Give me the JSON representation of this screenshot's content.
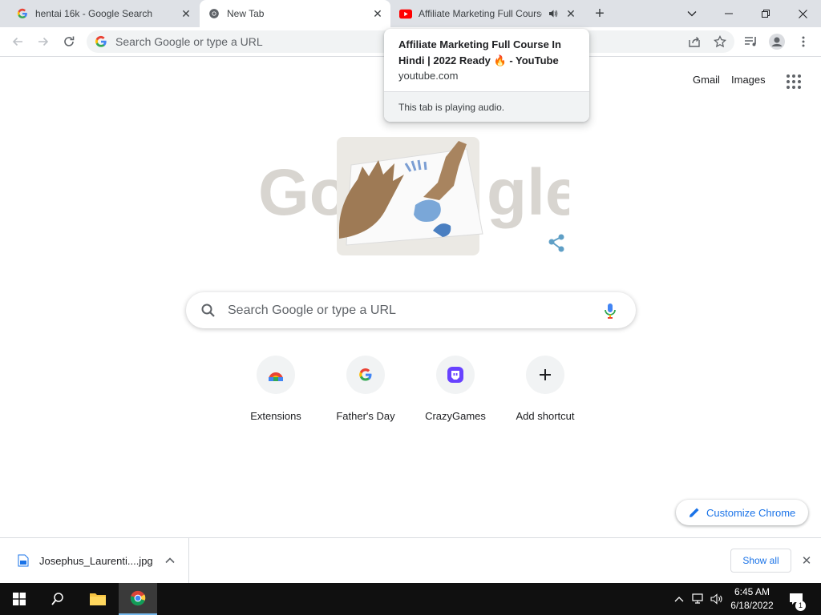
{
  "tabs": [
    {
      "title": "hentai 16k - Google Search",
      "favicon": "google-g-icon"
    },
    {
      "title": "New Tab",
      "favicon": "chrome-icon",
      "active": true
    },
    {
      "title": "Affiliate Marketing Full Course In Hindi | 2022 Ready 🔥 - YouTube",
      "favicon": "youtube-icon",
      "audio": true
    }
  ],
  "window_controls": [
    "tab-search",
    "minimize",
    "restore",
    "close"
  ],
  "omnibox": {
    "placeholder": "Search Google or type a URL"
  },
  "hovercard": {
    "title": "Affiliate Marketing Full Course In Hindi | 2022 Ready 🔥 - YouTube",
    "domain": "youtube.com",
    "status": "This tab is playing audio."
  },
  "ntp": {
    "gmail": "Gmail",
    "images": "Images",
    "search_placeholder": "Search Google or type a URL",
    "shortcuts": [
      {
        "label": "Extensions",
        "icon": "chrome-web-store-icon"
      },
      {
        "label": "Father's Day",
        "icon": "google-g-icon"
      },
      {
        "label": "CrazyGames",
        "icon": "crazygames-icon"
      },
      {
        "label": "Add shortcut",
        "icon": "plus-icon"
      }
    ],
    "customize": "Customize Chrome"
  },
  "downloads": {
    "file": "Josephus_Laurenti....jpg",
    "show_all": "Show all"
  },
  "taskbar": {
    "time": "6:45 AM",
    "date": "6/18/2022",
    "notification_count": "1"
  },
  "colors": {
    "tabstrip": "#dee1e6",
    "accent": "#1a73e8",
    "taskbar": "#101010"
  }
}
